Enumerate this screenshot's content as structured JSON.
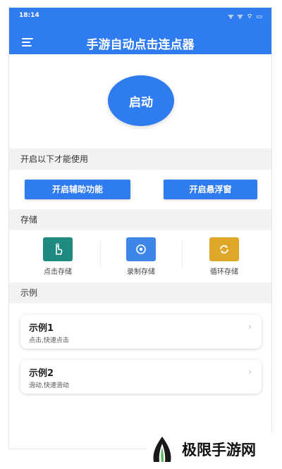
{
  "status": {
    "time": "18:14",
    "icons": "ᯤ ᯤ ⌔ ▭"
  },
  "header": {
    "title": "手游自动点击连点器"
  },
  "main": {
    "start_label": "启动",
    "section_permissions": "开启以下才能使用",
    "btn_accessibility": "开启辅助功能",
    "btn_float": "开启悬浮窗",
    "section_storage": "存储",
    "tiles": [
      {
        "label": "点击存储",
        "icon": "hand-tap-icon",
        "color": "#1f8a80"
      },
      {
        "label": "录制存储",
        "icon": "record-icon",
        "color": "#3d86e8"
      },
      {
        "label": "循环存储",
        "icon": "loop-icon",
        "color": "#e0a628"
      }
    ],
    "section_examples": "示例",
    "examples": [
      {
        "title": "示例1",
        "subtitle": "点击,快速点击"
      },
      {
        "title": "示例2",
        "subtitle": "滑动,快速滑动"
      }
    ]
  },
  "watermark": {
    "text": "极限手游网"
  }
}
